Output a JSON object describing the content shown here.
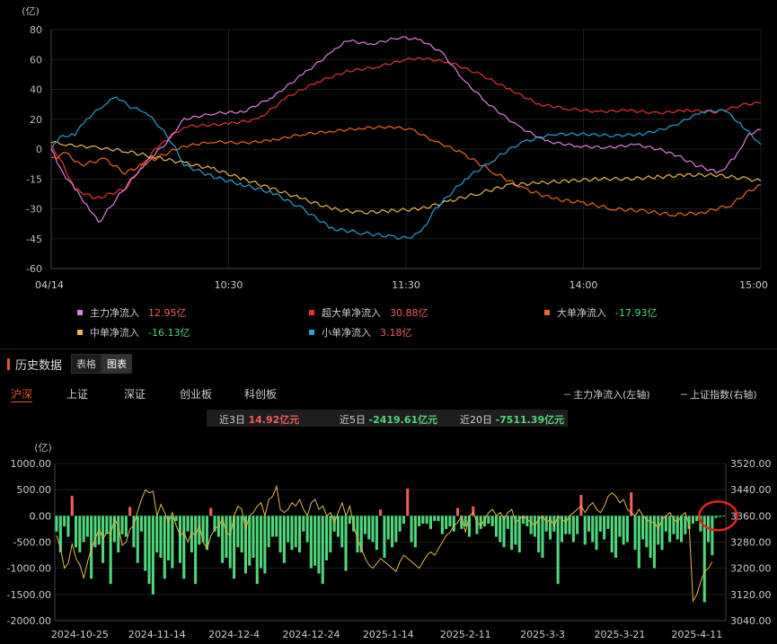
{
  "colors": {
    "main": "#e37ee0",
    "super": "#e8322e",
    "big": "#f0661f",
    "mid": "#e9b84a",
    "small": "#2a9fd6",
    "up": "#f25d5d",
    "down": "#4fd67a",
    "index": "#e9b84a",
    "highlight": "#e8231f"
  },
  "legend": [
    {
      "name": "主力净流入",
      "value": "12.95亿",
      "vcolor": "#f25d5d",
      "color": "#e37ee0"
    },
    {
      "name": "超大单净流入",
      "value": "30.88亿",
      "vcolor": "#f25d5d",
      "color": "#e8322e"
    },
    {
      "name": "大单净流入",
      "value": "-17.93亿",
      "vcolor": "#4fd67a",
      "color": "#f0661f"
    },
    {
      "name": "中单净流入",
      "value": "-16.13亿",
      "vcolor": "#4fd67a",
      "color": "#e9b84a"
    },
    {
      "name": "小单净流入",
      "value": "3.18亿",
      "vcolor": "#f25d5d",
      "color": "#2a9fd6"
    }
  ],
  "history": {
    "title": "历史数据",
    "tab_table": "表格",
    "tab_chart": "图表"
  },
  "markets": [
    "沪深",
    "上证",
    "深证",
    "创业板",
    "科创板"
  ],
  "bottom_legend": {
    "main": "主力净流入(左轴)",
    "index": "上证指数(右轴)"
  },
  "stats": [
    {
      "label": "近3日",
      "value": "14.92亿元",
      "vcolor": "#f25d5d"
    },
    {
      "label": "近5日",
      "value": "-2419.61亿元",
      "vcolor": "#4fd67a"
    },
    {
      "label": "近20日",
      "value": "-7511.39亿元",
      "vcolor": "#4fd67a"
    }
  ],
  "chart_data": [
    {
      "type": "line",
      "ylabel": "(亿)",
      "ylim": [
        -60,
        80
      ],
      "yticks": [
        80,
        60,
        40,
        20,
        0,
        -15,
        -30,
        -45,
        -60
      ],
      "x_ticks": [
        {
          "t": 0,
          "label": "04/14"
        },
        {
          "t": 60,
          "label": "10:30"
        },
        {
          "t": 120,
          "label": "11:30"
        },
        {
          "t": 180,
          "label": "14:00"
        },
        {
          "t": 240,
          "label": "15:00"
        }
      ],
      "x_range": [
        0,
        240
      ],
      "series": [
        {
          "name": "超大单净流入",
          "color": "#e8322e",
          "points": [
            [
              0,
              2
            ],
            [
              3,
              -5
            ],
            [
              8,
              -20
            ],
            [
              15,
              -25
            ],
            [
              25,
              -20
            ],
            [
              35,
              0
            ],
            [
              45,
              15
            ],
            [
              60,
              17
            ],
            [
              70,
              20
            ],
            [
              80,
              35
            ],
            [
              90,
              45
            ],
            [
              100,
              52
            ],
            [
              110,
              55
            ],
            [
              120,
              60
            ],
            [
              125,
              61
            ],
            [
              135,
              58
            ],
            [
              145,
              50
            ],
            [
              155,
              40
            ],
            [
              165,
              30
            ],
            [
              175,
              27
            ],
            [
              185,
              25
            ],
            [
              195,
              26
            ],
            [
              205,
              24
            ],
            [
              215,
              26
            ],
            [
              225,
              25
            ],
            [
              235,
              30
            ],
            [
              240,
              31
            ]
          ]
        },
        {
          "name": "主力净流入",
          "color": "#e37ee0",
          "points": [
            [
              0,
              0
            ],
            [
              3,
              -10
            ],
            [
              8,
              -20
            ],
            [
              13,
              -30
            ],
            [
              16,
              -37
            ],
            [
              22,
              -25
            ],
            [
              30,
              -10
            ],
            [
              38,
              2
            ],
            [
              45,
              20
            ],
            [
              55,
              24
            ],
            [
              65,
              25
            ],
            [
              75,
              35
            ],
            [
              85,
              50
            ],
            [
              95,
              65
            ],
            [
              100,
              73
            ],
            [
              108,
              70
            ],
            [
              118,
              75
            ],
            [
              125,
              73
            ],
            [
              132,
              65
            ],
            [
              140,
              45
            ],
            [
              148,
              30
            ],
            [
              158,
              15
            ],
            [
              168,
              5
            ],
            [
              178,
              2
            ],
            [
              188,
              1
            ],
            [
              198,
              3
            ],
            [
              210,
              -2
            ],
            [
              218,
              -8
            ],
            [
              226,
              -12
            ],
            [
              232,
              -3
            ],
            [
              236,
              10
            ],
            [
              240,
              13
            ]
          ]
        },
        {
          "name": "大单净流入",
          "color": "#f0661f",
          "points": [
            [
              0,
              -5
            ],
            [
              5,
              -2
            ],
            [
              10,
              -8
            ],
            [
              18,
              -5
            ],
            [
              25,
              -12
            ],
            [
              35,
              -5
            ],
            [
              45,
              2
            ],
            [
              55,
              5
            ],
            [
              65,
              4
            ],
            [
              75,
              6
            ],
            [
              85,
              10
            ],
            [
              95,
              12
            ],
            [
              105,
              14
            ],
            [
              115,
              15
            ],
            [
              122,
              13
            ],
            [
              130,
              5
            ],
            [
              140,
              -3
            ],
            [
              150,
              -12
            ],
            [
              160,
              -20
            ],
            [
              170,
              -25
            ],
            [
              180,
              -27
            ],
            [
              190,
              -30
            ],
            [
              200,
              -31
            ],
            [
              210,
              -33
            ],
            [
              220,
              -32
            ],
            [
              230,
              -28
            ],
            [
              235,
              -22
            ],
            [
              240,
              -18
            ]
          ]
        },
        {
          "name": "中单净流入",
          "color": "#e9b84a",
          "points": [
            [
              0,
              5
            ],
            [
              5,
              3
            ],
            [
              15,
              1
            ],
            [
              25,
              -1
            ],
            [
              35,
              -4
            ],
            [
              45,
              -7
            ],
            [
              55,
              -10
            ],
            [
              65,
              -15
            ],
            [
              75,
              -20
            ],
            [
              85,
              -25
            ],
            [
              95,
              -30
            ],
            [
              105,
              -32
            ],
            [
              115,
              -31
            ],
            [
              125,
              -30
            ],
            [
              135,
              -26
            ],
            [
              145,
              -22
            ],
            [
              155,
              -18
            ],
            [
              165,
              -17
            ],
            [
              175,
              -16
            ],
            [
              185,
              -15
            ],
            [
              195,
              -15
            ],
            [
              205,
              -14
            ],
            [
              215,
              -13
            ],
            [
              225,
              -13
            ],
            [
              235,
              -15
            ],
            [
              240,
              -16
            ]
          ]
        },
        {
          "name": "小单净流入",
          "color": "#2a9fd6",
          "points": [
            [
              0,
              0
            ],
            [
              3,
              8
            ],
            [
              8,
              10
            ],
            [
              12,
              20
            ],
            [
              18,
              30
            ],
            [
              22,
              35
            ],
            [
              27,
              28
            ],
            [
              32,
              25
            ],
            [
              38,
              12
            ],
            [
              45,
              -8
            ],
            [
              55,
              -14
            ],
            [
              65,
              -18
            ],
            [
              75,
              -22
            ],
            [
              85,
              -30
            ],
            [
              95,
              -40
            ],
            [
              105,
              -42
            ],
            [
              115,
              -44
            ],
            [
              120,
              -45
            ],
            [
              125,
              -42
            ],
            [
              130,
              -30
            ],
            [
              140,
              -15
            ],
            [
              150,
              -5
            ],
            [
              160,
              5
            ],
            [
              170,
              10
            ],
            [
              180,
              10
            ],
            [
              190,
              9
            ],
            [
              200,
              10
            ],
            [
              210,
              15
            ],
            [
              220,
              25
            ],
            [
              228,
              26
            ],
            [
              234,
              15
            ],
            [
              240,
              3
            ]
          ]
        }
      ]
    },
    {
      "type": "bar",
      "ylabel": "(亿)",
      "ylim": [
        -2000,
        1000
      ],
      "yticks": [
        1000,
        500,
        0,
        -500,
        -1000,
        -1500,
        -2000
      ],
      "ytick_labels": [
        "1000.00",
        "500.00",
        "0.00",
        "-500.00",
        "-1000.00",
        "-1500.00",
        "-2000.00"
      ],
      "y2lim": [
        3040,
        3520
      ],
      "y2ticks": [
        3520,
        3440,
        3360,
        3280,
        3200,
        3120,
        3040
      ],
      "y2tick_labels": [
        "3520.00",
        "3440.00",
        "3360.00",
        "3280.00",
        "3200.00",
        "3120.00",
        "3040.00"
      ],
      "x_tick_labels": [
        "2024-10-25",
        "2024-11-14",
        "2024-12-4",
        "2024-12-24",
        "2025-1-14",
        "2025-2-11",
        "2025-3-3",
        "2025-3-21",
        "2025-4-11"
      ],
      "x_tick_index": [
        6,
        26,
        46,
        66,
        86,
        106,
        126,
        146,
        166
      ],
      "values": [
        -300,
        -700,
        -200,
        -400,
        380,
        -600,
        -700,
        -500,
        -400,
        -1200,
        -600,
        -550,
        -900,
        -350,
        -1300,
        -500,
        -700,
        -350,
        -400,
        170,
        -600,
        -900,
        -300,
        -1050,
        -1300,
        -1500,
        -700,
        -800,
        -1200,
        -850,
        -1000,
        -100,
        -900,
        -1200,
        -300,
        -700,
        -1300,
        -550,
        -500,
        -650,
        150,
        -300,
        -400,
        -900,
        -800,
        -1000,
        -1200,
        -600,
        -700,
        -1100,
        -950,
        -800,
        -1300,
        -1000,
        -1100,
        -600,
        -400,
        -400,
        -700,
        -900,
        -500,
        -650,
        -600,
        -700,
        -300,
        -500,
        -1000,
        -950,
        -1100,
        -1300,
        -850,
        -700,
        -300,
        -400,
        -600,
        -1050,
        -150,
        -300,
        -700,
        -700,
        -350,
        -450,
        -500,
        -650,
        120,
        -800,
        -450,
        -600,
        -500,
        -300,
        -150,
        520,
        -500,
        -600,
        -200,
        -150,
        -150,
        -250,
        -100,
        -100,
        -350,
        -250,
        -200,
        -300,
        150,
        -250,
        -200,
        -400,
        180,
        -350,
        -250,
        -200,
        -150,
        -200,
        -400,
        -500,
        -600,
        -250,
        -650,
        -550,
        -700,
        -150,
        -200,
        -350,
        -400,
        -700,
        -800,
        -300,
        -450,
        -300,
        -1300,
        -500,
        -350,
        -350,
        -500,
        -350,
        400,
        -550,
        -300,
        -500,
        -650,
        -300,
        -450,
        -250,
        -700,
        -800,
        -400,
        -550,
        -500,
        450,
        -650,
        -1000,
        -450,
        -600,
        -800,
        -1000,
        -550,
        -650,
        -300,
        -500,
        -350,
        -450,
        -500,
        -350,
        -250,
        -150,
        -100,
        -300,
        -1650,
        -500,
        -750,
        -40,
        -20,
        -10
      ],
      "index": [
        3300,
        3260,
        3200,
        3215,
        3275,
        3230,
        3210,
        3170,
        3220,
        3260,
        3290,
        3320,
        3290,
        3310,
        3305,
        3350,
        3330,
        3270,
        3280,
        3320,
        3330,
        3375,
        3410,
        3440,
        3430,
        3435,
        3360,
        3395,
        3370,
        3340,
        3370,
        3330,
        3300,
        3310,
        3280,
        3310,
        3300,
        3330,
        3280,
        3260,
        3300,
        3320,
        3330,
        3350,
        3310,
        3300,
        3360,
        3390,
        3380,
        3320,
        3360,
        3370,
        3390,
        3400,
        3360,
        3410,
        3420,
        3450,
        3380,
        3370,
        3380,
        3400,
        3390,
        3410,
        3380,
        3360,
        3400,
        3410,
        3380,
        3390,
        3360,
        3370,
        3340,
        3370,
        3400,
        3360,
        3390,
        3330,
        3290,
        3260,
        3230,
        3210,
        3200,
        3215,
        3230,
        3220,
        3210,
        3200,
        3190,
        3220,
        3240,
        3230,
        3220,
        3210,
        3200,
        3220,
        3240,
        3250,
        3240,
        3260,
        3280,
        3300,
        3310,
        3330,
        3340,
        3360,
        3310,
        3360,
        3370,
        3340,
        3330,
        3350,
        3370,
        3380,
        3360,
        3370,
        3350,
        3370,
        3380,
        3340,
        3350,
        3360,
        3350,
        3340,
        3330,
        3350,
        3360,
        3340,
        3350,
        3330,
        3360,
        3350,
        3340,
        3360,
        3370,
        3380,
        3390,
        3370,
        3390,
        3400,
        3380,
        3370,
        3390,
        3420,
        3430,
        3420,
        3400,
        3410,
        3380,
        3370,
        3360,
        3380,
        3360,
        3350,
        3340,
        3340,
        3320,
        3350,
        3360,
        3370,
        3350,
        3340,
        3360,
        3370,
        3330,
        3100,
        3120,
        3160,
        3190,
        3200,
        3220
      ]
    }
  ]
}
